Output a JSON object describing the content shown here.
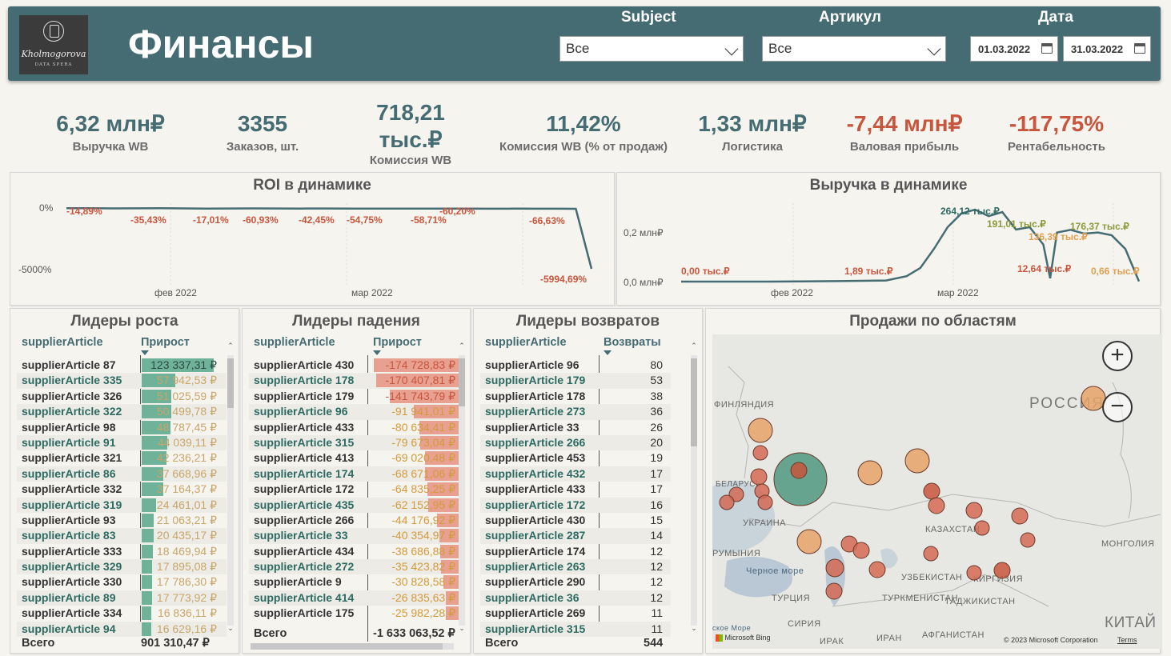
{
  "header": {
    "title": "Финансы",
    "logo_name": "Kholmogorova",
    "logo_sub": "DATA SPERA",
    "filters": {
      "subject_label": "Subject",
      "subject_value": "Все",
      "article_label": "Артикул",
      "article_value": "Все",
      "date_label": "Дата",
      "date_from": "01.03.2022",
      "date_to": "31.03.2022"
    }
  },
  "kpis": {
    "revenue": {
      "value": "6,32 млн₽",
      "label": "Выручка WB"
    },
    "orders": {
      "value": "3355",
      "label": "Заказов, шт."
    },
    "commission": {
      "value_line1": "718,21",
      "value_line2": "тыс.₽",
      "label": "Комиссия WB"
    },
    "commission_pct": {
      "value": "11,42%",
      "label": "Комиссия WB (% от продаж)"
    },
    "logistics": {
      "value": "1,33 млн₽",
      "label": "Логистика"
    },
    "gross": {
      "value": "-7,44 млн₽",
      "label": "Валовая прибыль"
    },
    "profitability": {
      "value": "-117,75%",
      "label": "Рентабельность"
    }
  },
  "colors": {
    "accent": "#456b73",
    "negative": "#c8553d",
    "teal": "#2d6a62",
    "green_bar": "#6fb29a",
    "red_bar": "#e8a090"
  },
  "chart_data": [
    {
      "type": "line",
      "title": "ROI в динамике",
      "ytick_labels": [
        "0%",
        "-5000%"
      ],
      "xtick_labels": [
        "фев 2022",
        "мар 2022"
      ],
      "ylim": [
        -5994.69,
        0
      ],
      "data_labels": [
        "-14,89%",
        "-35,43%",
        "-17,01%",
        "-60,93%",
        "-42,45%",
        "-54,75%",
        "-58,71%",
        "-60,20%",
        "-66,63%",
        "-5994,69%"
      ],
      "x": [
        "2022-01-23",
        "2022-01-26",
        "2022-01-29",
        "2022-02-01",
        "2022-02-04",
        "2022-02-07",
        "2022-02-10",
        "2022-02-13",
        "2022-02-16",
        "2022-02-19",
        "2022-02-22",
        "2022-02-25",
        "2022-02-28",
        "2022-03-03",
        "2022-03-06",
        "2022-03-09",
        "2022-03-12",
        "2022-03-15",
        "2022-03-18",
        "2022-03-21",
        "2022-03-24",
        "2022-03-27",
        "2022-03-29",
        "2022-03-31"
      ],
      "values": [
        -14.89,
        -20,
        -35.43,
        -25,
        -17.01,
        -40,
        -60.93,
        -45,
        -42.45,
        -50,
        -54.75,
        -48,
        -58.71,
        -55,
        -60.2,
        -55,
        -58,
        -62,
        -66.63,
        -64,
        -68,
        -70,
        -80,
        -5994.69
      ]
    },
    {
      "type": "line",
      "title": "Выручка в динамике",
      "ytick_labels": [
        "0,2 млн₽",
        "0,0 млн₽"
      ],
      "xtick_labels": [
        "фев 2022",
        "мар 2022"
      ],
      "ylim": [
        0,
        0.27
      ],
      "data_labels": [
        "0,00 тыс.₽",
        "1,89 тыс.₽",
        "264,12 тыс.₽",
        "191,01 тыс.₽",
        "136,39 тыс.₽",
        "12,64 тыс.₽",
        "176,37 тыс.₽",
        "0,66 тыс.₽"
      ],
      "x": [
        "2022-01-23",
        "2022-02-05",
        "2022-02-15",
        "2022-02-22",
        "2022-02-25",
        "2022-02-27",
        "2022-03-01",
        "2022-03-03",
        "2022-03-05",
        "2022-03-07",
        "2022-03-09",
        "2022-03-11",
        "2022-03-13",
        "2022-03-15",
        "2022-03-17",
        "2022-03-18",
        "2022-03-19",
        "2022-03-21",
        "2022-03-23",
        "2022-03-25",
        "2022-03-27",
        "2022-03-29",
        "2022-03-31"
      ],
      "values": [
        0,
        0,
        0.0019,
        0.004,
        0.02,
        0.05,
        0.12,
        0.2,
        0.25,
        0.264,
        0.24,
        0.255,
        0.191,
        0.2,
        0.136,
        0.012,
        0.18,
        0.19,
        0.176,
        0.18,
        0.17,
        0.12,
        0.0007
      ]
    }
  ],
  "growth_table": {
    "title": "Лидеры роста",
    "col1": "supplierArticle",
    "col2": "Прирост",
    "total_label": "Всего",
    "total_value": "901 310,47 ₽",
    "rows": [
      {
        "name": "supplierArticle 87",
        "value": "123 337,31 ₽",
        "frac": 1.0
      },
      {
        "name": "supplierArticle 335",
        "value": "57 942,53 ₽",
        "frac": 0.47
      },
      {
        "name": "supplierArticle 326",
        "value": "51 025,59 ₽",
        "frac": 0.414
      },
      {
        "name": "supplierArticle 322",
        "value": "50 499,78 ₽",
        "frac": 0.409
      },
      {
        "name": "supplierArticle 98",
        "value": "48 787,45 ₽",
        "frac": 0.396
      },
      {
        "name": "supplierArticle 91",
        "value": "44 039,11 ₽",
        "frac": 0.357
      },
      {
        "name": "supplierArticle 321",
        "value": "42 236,21 ₽",
        "frac": 0.342
      },
      {
        "name": "supplierArticle 86",
        "value": "37 668,96 ₽",
        "frac": 0.305
      },
      {
        "name": "supplierArticle 332",
        "value": "37 164,37 ₽",
        "frac": 0.301
      },
      {
        "name": "supplierArticle 319",
        "value": "24 461,01 ₽",
        "frac": 0.198
      },
      {
        "name": "supplierArticle 93",
        "value": "21 063,21 ₽",
        "frac": 0.171
      },
      {
        "name": "supplierArticle 83",
        "value": "20 435,17 ₽",
        "frac": 0.166
      },
      {
        "name": "supplierArticle 333",
        "value": "18 469,94 ₽",
        "frac": 0.15
      },
      {
        "name": "supplierArticle 329",
        "value": "17 895,08 ₽",
        "frac": 0.145
      },
      {
        "name": "supplierArticle 330",
        "value": "17 786,30 ₽",
        "frac": 0.144
      },
      {
        "name": "supplierArticle 89",
        "value": "17 773,92 ₽",
        "frac": 0.144
      },
      {
        "name": "supplierArticle 334",
        "value": "16 836,11 ₽",
        "frac": 0.137
      },
      {
        "name": "supplierArticle 94",
        "value": "16 629,16 ₽",
        "frac": 0.135
      }
    ]
  },
  "decline_table": {
    "title": "Лидеры падения",
    "col1": "supplierArticle",
    "col2": "Прирост",
    "total_label": "Всего",
    "total_value": "-1 633 063,52 ₽",
    "rows": [
      {
        "name": "supplierArticle 430",
        "value": "-174 728,83 ₽",
        "frac": 1.0
      },
      {
        "name": "supplierArticle 178",
        "value": "-170 407,81 ₽",
        "frac": 0.975
      },
      {
        "name": "supplierArticle 179",
        "value": "-141 743,79 ₽",
        "frac": 0.811
      },
      {
        "name": "supplierArticle 96",
        "value": "-91 941,01 ₽",
        "frac": 0.526
      },
      {
        "name": "supplierArticle 433",
        "value": "-80 634,41 ₽",
        "frac": 0.461
      },
      {
        "name": "supplierArticle 315",
        "value": "-79 673,04 ₽",
        "frac": 0.456
      },
      {
        "name": "supplierArticle 413",
        "value": "-69 020,48 ₽",
        "frac": 0.395
      },
      {
        "name": "supplierArticle 174",
        "value": "-68 671,06 ₽",
        "frac": 0.393
      },
      {
        "name": "supplierArticle 172",
        "value": "-64 835,25 ₽",
        "frac": 0.371
      },
      {
        "name": "supplierArticle 435",
        "value": "-62 152,95 ₽",
        "frac": 0.356
      },
      {
        "name": "supplierArticle 266",
        "value": "-44 176,92 ₽",
        "frac": 0.253
      },
      {
        "name": "supplierArticle 33",
        "value": "-40 354,97 ₽",
        "frac": 0.231
      },
      {
        "name": "supplierArticle 434",
        "value": "-38 686,88 ₽",
        "frac": 0.221
      },
      {
        "name": "supplierArticle 272",
        "value": "-35 423,82 ₽",
        "frac": 0.203
      },
      {
        "name": "supplierArticle 9",
        "value": "-30 828,58 ₽",
        "frac": 0.176
      },
      {
        "name": "supplierArticle 414",
        "value": "-26 835,63 ₽",
        "frac": 0.154
      },
      {
        "name": "supplierArticle 175",
        "value": "-25 982,28 ₽",
        "frac": 0.149
      }
    ]
  },
  "returns_table": {
    "title": "Лидеры возвратов",
    "col1": "supplierArticle",
    "col2": "Возвраты",
    "total_label": "Всего",
    "total_value": "544",
    "rows": [
      {
        "name": "supplierArticle 96",
        "value": "80"
      },
      {
        "name": "supplierArticle 179",
        "value": "53"
      },
      {
        "name": "supplierArticle 178",
        "value": "38"
      },
      {
        "name": "supplierArticle 273",
        "value": "36"
      },
      {
        "name": "supplierArticle 33",
        "value": "26"
      },
      {
        "name": "supplierArticle 266",
        "value": "20"
      },
      {
        "name": "supplierArticle 453",
        "value": "19"
      },
      {
        "name": "supplierArticle 432",
        "value": "17"
      },
      {
        "name": "supplierArticle 433",
        "value": "17"
      },
      {
        "name": "supplierArticle 172",
        "value": "16"
      },
      {
        "name": "supplierArticle 430",
        "value": "15"
      },
      {
        "name": "supplierArticle 287",
        "value": "14"
      },
      {
        "name": "supplierArticle 174",
        "value": "12"
      },
      {
        "name": "supplierArticle 263",
        "value": "12"
      },
      {
        "name": "supplierArticle 290",
        "value": "12"
      },
      {
        "name": "supplierArticle 36",
        "value": "12"
      },
      {
        "name": "supplierArticle 269",
        "value": "11"
      },
      {
        "name": "supplierArticle 315",
        "value": "11"
      }
    ]
  },
  "map": {
    "title": "Продажи по областям",
    "labels": {
      "russia": "РОССИЯ",
      "finland": "ФИНЛЯНДИЯ",
      "belarus": "БЕЛАРУСЬ",
      "ukraine": "УКРАИНА",
      "kazakhstan": "КАЗАХСТАН",
      "mongolia": "МОНГОЛИЯ",
      "romania": "РУМЫНИЯ",
      "black_sea": "Черное море",
      "uzbekistan": "УЗБЕКИСТАН",
      "turkmenistan": "ТУРКМЕНИСТАН",
      "kyrgyzstan": "КИРГИЗИЯ",
      "tajikistan": "ТАДЖИКИСТАН",
      "turkey": "ТУРЦИЯ",
      "syria": "СИРИЯ",
      "iraq": "ИРАК",
      "iran": "ИРАН",
      "afghanistan": "АФГАНИСТАН",
      "china": "КИТАЙ",
      "sea": "ское Море"
    },
    "footer_bing": "Microsoft Bing",
    "footer_copyright": "© 2023 Microsoft Corporation",
    "footer_terms": "Terms"
  }
}
